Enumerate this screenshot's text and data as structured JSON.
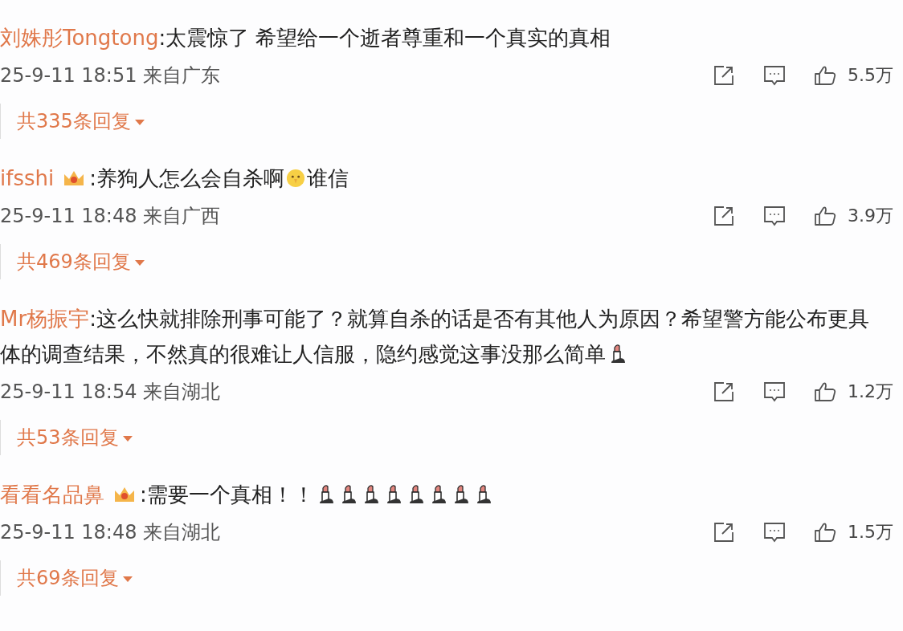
{
  "comments": [
    {
      "user": "刘姝彤Tongtong",
      "badge": false,
      "content": [
        {
          "kind": "text",
          "text": ":太震惊了 希望给一个逝者尊重和一个真实的真相"
        }
      ],
      "time": "25-9-11 18:51",
      "location": "来自广东",
      "likes": "5.5万",
      "replies": "共335条回复"
    },
    {
      "user": "ifsshi",
      "badge": true,
      "content": [
        {
          "kind": "text",
          "text": ":养狗人怎么会自杀啊"
        },
        {
          "kind": "face"
        },
        {
          "kind": "text",
          "text": "谁信"
        }
      ],
      "time": "25-9-11 18:48",
      "location": "来自广西",
      "likes": "3.9万",
      "replies": "共469条回复"
    },
    {
      "user": "Mr杨振宇",
      "badge": false,
      "content": [
        {
          "kind": "text",
          "text": ":这么快就排除刑事可能了？就算自杀的话是否有其他人为原因？希望警方能公布更具体的调查结果，不然真的很难让人信服，隐约感觉这事没那么简单"
        },
        {
          "kind": "lipstick"
        }
      ],
      "time": "25-9-11 18:54",
      "location": "来自湖北",
      "likes": "1.2万",
      "replies": "共53条回复"
    },
    {
      "user": "看看名品鼻",
      "badge": true,
      "content": [
        {
          "kind": "text",
          "text": ":需要一个真相！！"
        },
        {
          "kind": "lipstick"
        },
        {
          "kind": "lipstick"
        },
        {
          "kind": "lipstick"
        },
        {
          "kind": "lipstick"
        },
        {
          "kind": "lipstick"
        },
        {
          "kind": "lipstick"
        },
        {
          "kind": "lipstick"
        },
        {
          "kind": "lipstick"
        }
      ],
      "time": "25-9-11 18:48",
      "location": "来自湖北",
      "likes": "1.5万",
      "replies": "共69条回复"
    }
  ]
}
